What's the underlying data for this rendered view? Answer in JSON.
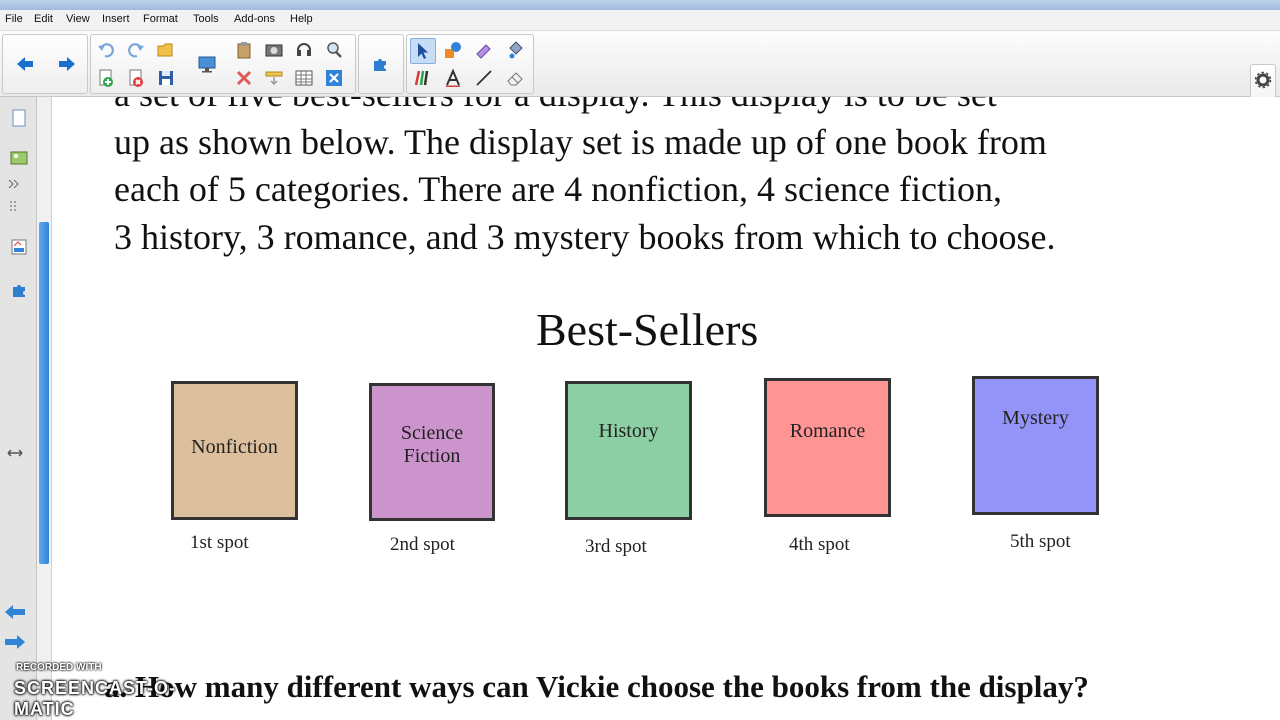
{
  "menu": [
    "File",
    "Edit",
    "View",
    "Insert",
    "Format",
    "Tools",
    "Add-ons",
    "Help"
  ],
  "content": {
    "paragraph_lines": [
      "a set of five best-sellers for a display.  This display is to be set",
      "up as shown below. The display set is made up of one book from",
      "each of 5 categories. There are 4 nonfiction, 4 science fiction,",
      "3 history, 3 romance, and 3 mystery books from which to choose."
    ],
    "heading": "Best-Sellers",
    "books": [
      {
        "label": "Nonfiction",
        "spot": "1st spot",
        "color": "#dcbf9c"
      },
      {
        "label": "Science Fiction",
        "spot": "2nd spot",
        "color": "#cc94cc"
      },
      {
        "label": "History",
        "spot": "3rd spot",
        "color": "#8dcfa4"
      },
      {
        "label": "Romance",
        "spot": "4th spot",
        "color": "#ff9494"
      },
      {
        "label": "Mystery",
        "spot": "5th spot",
        "color": "#9494f8"
      }
    ],
    "question": "a. How many different ways can Vickie choose the books from the display?"
  },
  "watermark": {
    "line1": "RECORDED WITH",
    "line2": "SCREENCAST-O-MATIC"
  },
  "icons": {
    "nav": [
      "back-arrow-icon",
      "forward-arrow-icon"
    ],
    "toolbar": [
      "undo-icon",
      "redo-icon",
      "open-file-icon",
      "add-page-icon",
      "delete-page-icon",
      "save-icon",
      "screen-shade-icon",
      "paste-icon",
      "capture-icon",
      "record-icon",
      "delete-icon",
      "show-hide-icon",
      "table-icon",
      "close-box-icon",
      "add-ons-icon",
      "select-icon",
      "pen-icon",
      "creative-pen-icon",
      "text-icon",
      "line-icon",
      "eraser-icon",
      "magic-pen-icon",
      "fill-icon"
    ],
    "sidebar": [
      "page-sorter-icon",
      "gallery-icon",
      "attachments-icon",
      "properties-icon",
      "add-ons-icon",
      "collapse-icon",
      "page-left-icon",
      "page-right-icon"
    ]
  },
  "colors": {
    "accent": "#2f84d8",
    "toolbar_blue": "#1a6fcf"
  }
}
